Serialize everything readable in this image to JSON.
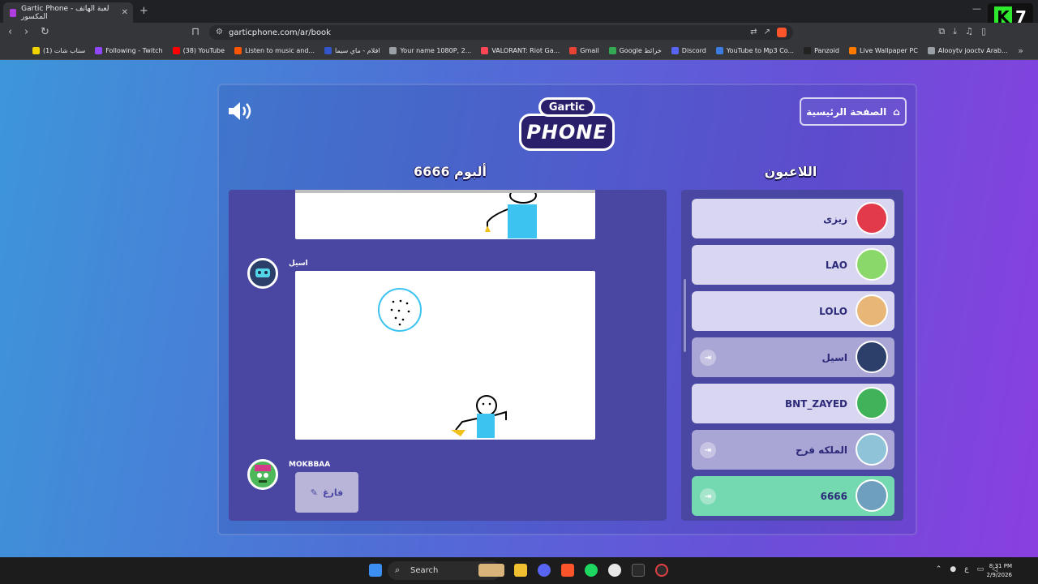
{
  "browser": {
    "tab_title": "Gartic Phone - لعبة الهاتف المكسور",
    "tab_close": "✕",
    "new_tab": "+",
    "url": "garticphone.com/ar/book",
    "bookmarks": [
      {
        "label": "سناب شات (1)",
        "color": "#f2d300"
      },
      {
        "label": "Following - Twitch",
        "color": "#9146ff"
      },
      {
        "label": "(38) YouTube",
        "color": "#ff0000"
      },
      {
        "label": "Listen to music and...",
        "color": "#ff5500"
      },
      {
        "label": "افلام - ماي سيما",
        "color": "#3355cc"
      },
      {
        "label": "Your name 1080P, 2...",
        "color": "#9aa0a6"
      },
      {
        "label": "VALORANT: Riot Ga...",
        "color": "#ff4655"
      },
      {
        "label": "Gmail",
        "color": "#ea4335"
      },
      {
        "label": "Google خرائط",
        "color": "#34a853"
      },
      {
        "label": "Discord",
        "color": "#5865f2"
      },
      {
        "label": "YouTube to Mp3 Co...",
        "color": "#3c7be0"
      },
      {
        "label": "Panzoid",
        "color": "#222222"
      },
      {
        "label": "Live Wallpaper PC",
        "color": "#ff7a00"
      },
      {
        "label": "Alooytv jooctv Arab...",
        "color": "#9aa0a6"
      }
    ],
    "more_bookmarks": "»"
  },
  "game": {
    "home_button": "الصفحة الرئيسية",
    "logo_top": "Gartic",
    "logo_bottom": "PHONE",
    "album_title": "ألبوم 6666",
    "players_title": "اللاعبون",
    "album_entries": [
      {
        "user": "اسيل",
        "type": "drawing"
      },
      {
        "user": "MOKBBAA",
        "type": "empty",
        "label": "فارغ"
      }
    ],
    "players": [
      {
        "name": "زيزى",
        "state": "normal",
        "color": "#e23a4a"
      },
      {
        "name": "LAO",
        "state": "normal",
        "color": "#8bd86a"
      },
      {
        "name": "LOLO",
        "state": "normal",
        "color": "#e8b777"
      },
      {
        "name": "اسيل",
        "state": "dim",
        "color": "#2b3f6a"
      },
      {
        "name": "BNT_ZAYED",
        "state": "normal",
        "color": "#3fb25a"
      },
      {
        "name": "الملكه فرح",
        "state": "dim",
        "color": "#8fc4d8"
      },
      {
        "name": "6666",
        "state": "active",
        "color": "#6f9fbf"
      }
    ]
  },
  "taskbar": {
    "search_label": "Search",
    "time": "8:31 PM",
    "date": "2/9/2026",
    "lang": "ع"
  }
}
